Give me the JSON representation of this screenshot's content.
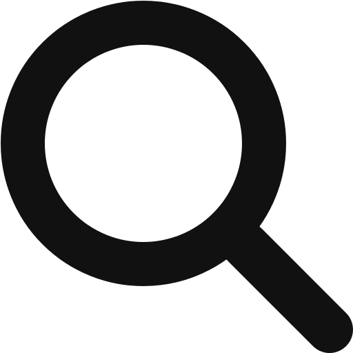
{
  "icon": {
    "name": "search-icon",
    "color": "#111111",
    "background": "#ffffff"
  }
}
